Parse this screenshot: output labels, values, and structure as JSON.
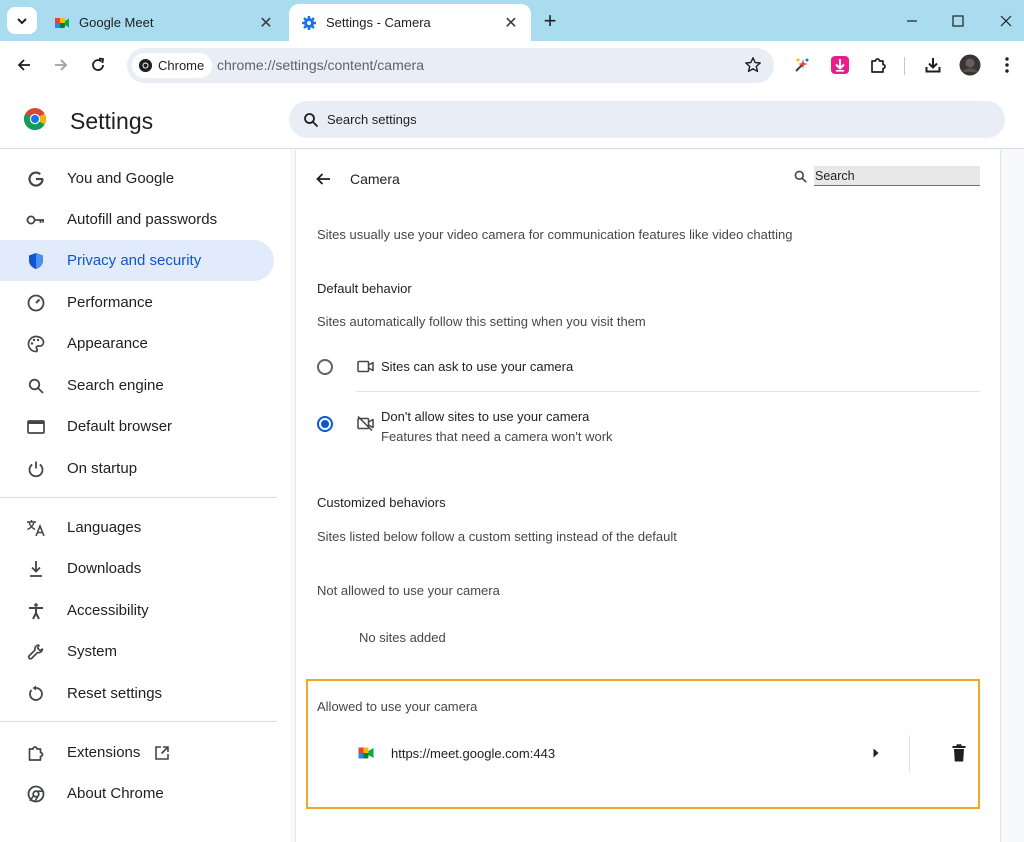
{
  "tabs": [
    {
      "title": "Google Meet",
      "icon": "google-meet-icon",
      "active": false
    },
    {
      "title": "Settings - Camera",
      "icon": "gear-icon",
      "active": true
    }
  ],
  "toolbar": {
    "chip_label": "Chrome",
    "url": "chrome://settings/content/camera"
  },
  "header": {
    "title": "Settings",
    "search_placeholder": "Search settings"
  },
  "sidebar": {
    "items": [
      {
        "label": "You and Google",
        "icon": "google-g-icon"
      },
      {
        "label": "Autofill and passwords",
        "icon": "key-icon"
      },
      {
        "label": "Privacy and security",
        "icon": "shield-icon",
        "active": true
      },
      {
        "label": "Performance",
        "icon": "speedometer-icon"
      },
      {
        "label": "Appearance",
        "icon": "palette-icon"
      },
      {
        "label": "Search engine",
        "icon": "search-icon"
      },
      {
        "label": "Default browser",
        "icon": "browser-window-icon"
      },
      {
        "label": "On startup",
        "icon": "power-icon"
      },
      {
        "label": "Languages",
        "icon": "translate-icon"
      },
      {
        "label": "Downloads",
        "icon": "download-icon"
      },
      {
        "label": "Accessibility",
        "icon": "accessibility-icon"
      },
      {
        "label": "System",
        "icon": "wrench-icon"
      },
      {
        "label": "Reset settings",
        "icon": "reset-icon"
      },
      {
        "label": "Extensions",
        "icon": "puzzle-icon"
      },
      {
        "label": "About Chrome",
        "icon": "chrome-icon"
      }
    ]
  },
  "camera": {
    "heading": "Camera",
    "search_placeholder": "Search",
    "description": "Sites usually use your video camera for communication features like video chatting",
    "default_behavior": {
      "title": "Default behavior",
      "subtitle": "Sites automatically follow this setting when you visit them",
      "options": [
        {
          "label": "Sites can ask to use your camera",
          "sublabel": "",
          "selected": false
        },
        {
          "label": "Don't allow sites to use your camera",
          "sublabel": "Features that need a camera won't work",
          "selected": true
        }
      ]
    },
    "customized": {
      "title": "Customized behaviors",
      "subtitle": "Sites listed below follow a custom setting instead of the default",
      "not_allowed_title": "Not allowed to use your camera",
      "not_allowed_empty": "No sites added",
      "allowed_title": "Allowed to use your camera",
      "allowed_sites": [
        {
          "url": "https://meet.google.com:443",
          "icon": "google-meet-icon"
        }
      ]
    }
  },
  "colors": {
    "accent": "#0b57d0",
    "tabstrip": "#a8dcee",
    "highlight_border": "#f2a823",
    "active_nav_bg": "#e2ebfb"
  }
}
